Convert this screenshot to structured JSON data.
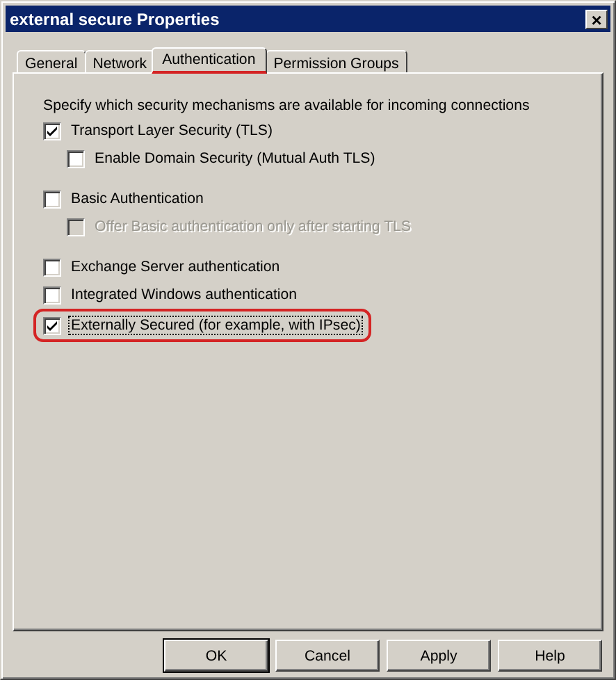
{
  "window": {
    "title": "external secure Properties",
    "close": "×"
  },
  "tabs": [
    {
      "label": "General",
      "selected": false,
      "marked": false
    },
    {
      "label": "Network",
      "selected": false,
      "marked": false
    },
    {
      "label": "Authentication",
      "selected": true,
      "marked": true
    },
    {
      "label": "Permission Groups",
      "selected": false,
      "marked": false
    }
  ],
  "intro": "Specify which security mechanisms are available for incoming connections",
  "groups": [
    [
      {
        "label": "Transport Layer Security (TLS)",
        "checked": true,
        "disabled": false,
        "highlighted": false,
        "children": [
          {
            "label": "Enable Domain Security (Mutual Auth TLS)",
            "checked": false,
            "disabled": false,
            "highlighted": false
          }
        ]
      }
    ],
    [
      {
        "label": "Basic Authentication",
        "checked": false,
        "disabled": false,
        "highlighted": false,
        "children": [
          {
            "label": "Offer Basic authentication only after starting TLS",
            "checked": false,
            "disabled": true,
            "highlighted": false
          }
        ]
      }
    ],
    [
      {
        "label": "Exchange Server authentication",
        "checked": false,
        "disabled": false,
        "highlighted": false
      },
      {
        "label": "Integrated Windows authentication",
        "checked": false,
        "disabled": false,
        "highlighted": false
      },
      {
        "label": "Externally Secured (for example, with IPsec)",
        "checked": true,
        "disabled": false,
        "highlighted": true
      }
    ]
  ],
  "buttons": [
    {
      "label": "OK",
      "default": true
    },
    {
      "label": "Cancel",
      "default": false
    },
    {
      "label": "Apply",
      "default": false
    },
    {
      "label": "Help",
      "default": false
    }
  ]
}
